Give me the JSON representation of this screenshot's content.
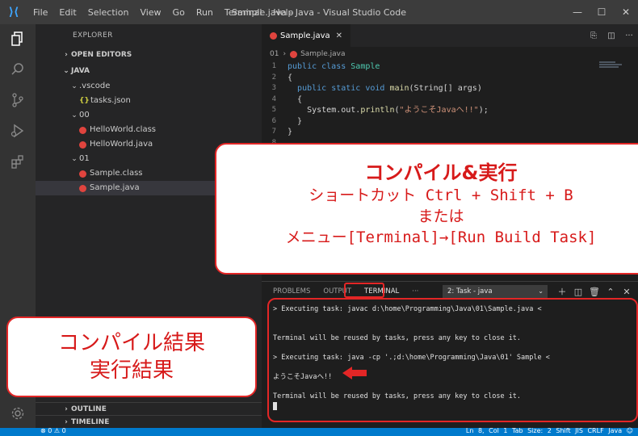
{
  "titlebar": {
    "title": "Sample.java - Java - Visual Studio Code",
    "menu": [
      "File",
      "Edit",
      "Selection",
      "View",
      "Go",
      "Run",
      "Terminal",
      "Help"
    ]
  },
  "sidebar": {
    "header": "EXPLORER",
    "open_editors": "OPEN EDITORS",
    "workspace": "JAVA",
    "tree": [
      ".vscode",
      "tasks.json",
      "00",
      "HelloWorld.class",
      "HelloWorld.java",
      "01",
      "Sample.class",
      "Sample.java"
    ],
    "outline": "OUTLINE",
    "timeline": "TIMELINE"
  },
  "editor": {
    "tab": "Sample.java",
    "breadcrumb_folder": "01",
    "breadcrumb_file": "Sample.java",
    "line_numbers": [
      "1",
      "2",
      "3",
      "4",
      "5",
      "6",
      "7",
      "8"
    ],
    "line1_kw": "public class ",
    "line1_cls": "Sample",
    "line2": "{",
    "line3_kw": "public static void ",
    "line3_fn": "main",
    "line3_rest": "(String[] args)",
    "line4": "{",
    "line5_pre": "System.out.",
    "line5_fn": "println",
    "line5_open": "(",
    "line5_str": "\"ようこそJavaへ!!\"",
    "line5_close": ");",
    "line6": "}",
    "line7": "}"
  },
  "panel": {
    "tabs": [
      "PROBLEMS",
      "OUTPUT",
      "TERMINAL",
      "···"
    ],
    "task": "2: Task - java",
    "terminal": [
      "> Executing task: javac d:\\home\\Programming\\Java\\01\\Sample.java <",
      "Terminal will be reused by tasks, press any key to close it.",
      "> Executing task: java -cp '.;d:\\home\\Programming\\Java\\01' Sample <",
      "ようこそJavaへ!!",
      "Terminal will be reused by tasks, press any key to close it."
    ]
  },
  "statusbar": {
    "left": "⊗ 0 ⚠ 0",
    "right": "Ln 8, Col 1   Tab Size: 2   Shift JIS   CRLF   Java   ☺"
  },
  "callout_top": {
    "title": "コンパイル&実行",
    "line1": "ショートカット Ctrl + Shift + B",
    "line2": "または",
    "line3": "メニュー[Terminal]→[Run Build Task]"
  },
  "callout_left": {
    "line1": "コンパイル結果",
    "line2": "実行結果"
  },
  "colors": {
    "accent_red": "#e32626",
    "status_blue": "#007acc"
  }
}
